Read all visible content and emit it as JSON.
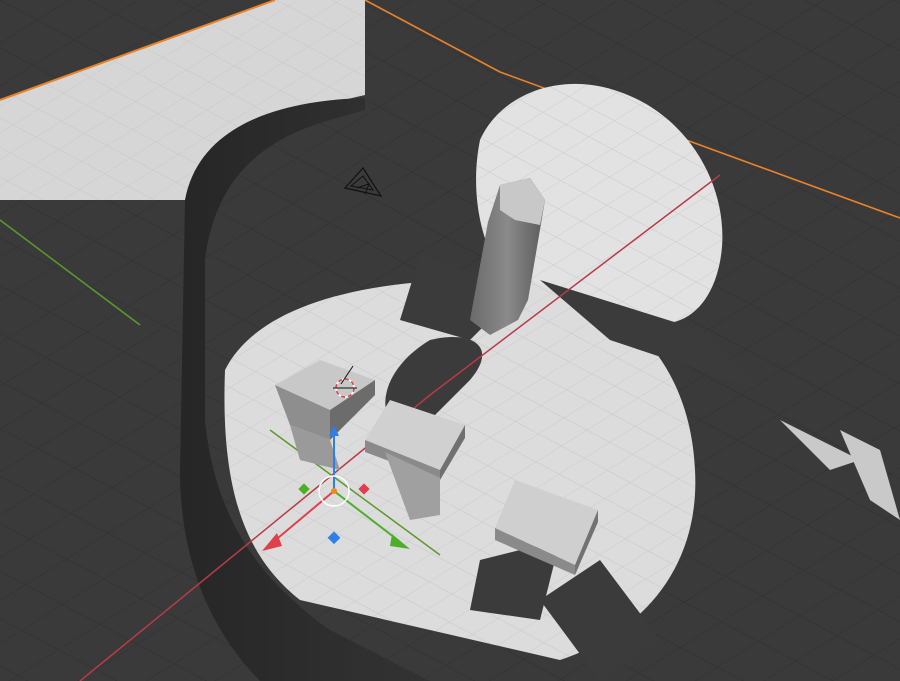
{
  "viewport": {
    "background_color": "#3a3a3a",
    "grid_color": "#2f2f2f",
    "axis_x_color": "#b83a48",
    "axis_y_color": "#5a9a2a",
    "selection_outline_color": "#e8832a"
  },
  "scene": {
    "ground_light_color": "#d9d9d9",
    "wall_color": "#2b2b2b",
    "object_color": "#cfcfcf",
    "shadow_color": "#3c3c3c"
  },
  "gizmo": {
    "icon": "transform-gizmo-icon",
    "x_color": "#e0404c",
    "y_color": "#4caf2a",
    "z_color": "#2f7fe8",
    "origin_color": "#f08a1a"
  },
  "icons": {
    "camera": "camera-icon",
    "cursor": "3d-cursor-icon"
  }
}
